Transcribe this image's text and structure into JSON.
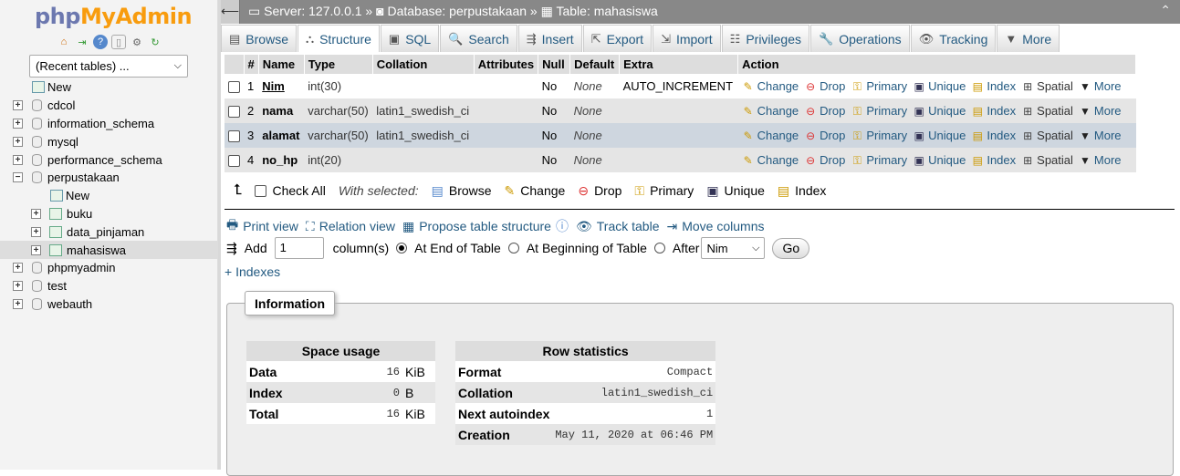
{
  "logo": {
    "part1": "php",
    "part2": "MyAdmin"
  },
  "sidebar": {
    "recent_tables": "(Recent tables) ...",
    "tree": [
      {
        "label": "New",
        "type": "new",
        "level": 0
      },
      {
        "label": "cdcol",
        "type": "db",
        "level": 0
      },
      {
        "label": "information_schema",
        "type": "db",
        "level": 0
      },
      {
        "label": "mysql",
        "type": "db",
        "level": 0
      },
      {
        "label": "performance_schema",
        "type": "db",
        "level": 0
      },
      {
        "label": "perpustakaan",
        "type": "db",
        "level": 0,
        "expanded": true
      },
      {
        "label": "New",
        "type": "new",
        "level": 1
      },
      {
        "label": "buku",
        "type": "table",
        "level": 1
      },
      {
        "label": "data_pinjaman",
        "type": "table",
        "level": 1
      },
      {
        "label": "mahasiswa",
        "type": "table",
        "level": 1,
        "selected": true
      },
      {
        "label": "phpmyadmin",
        "type": "db",
        "level": 0
      },
      {
        "label": "test",
        "type": "db",
        "level": 0
      },
      {
        "label": "webauth",
        "type": "db",
        "level": 0
      }
    ]
  },
  "breadcrumb": {
    "server": "Server: 127.0.0.1",
    "sep": "»",
    "database": "Database: perpustakaan",
    "table": "Table: mahasiswa"
  },
  "tabs": [
    {
      "label": "Browse",
      "icon": "browse-icon",
      "glyph": "▤"
    },
    {
      "label": "Structure",
      "icon": "structure-icon",
      "glyph": "⛬",
      "active": true
    },
    {
      "label": "SQL",
      "icon": "sql-icon",
      "glyph": "▣"
    },
    {
      "label": "Search",
      "icon": "search-icon",
      "glyph": "🔍"
    },
    {
      "label": "Insert",
      "icon": "insert-icon",
      "glyph": "⇶"
    },
    {
      "label": "Export",
      "icon": "export-icon",
      "glyph": "⇱"
    },
    {
      "label": "Import",
      "icon": "import-icon",
      "glyph": "⇲"
    },
    {
      "label": "Privileges",
      "icon": "privileges-icon",
      "glyph": "☷"
    },
    {
      "label": "Operations",
      "icon": "wrench-icon",
      "glyph": "🔧"
    },
    {
      "label": "Tracking",
      "icon": "eye-icon",
      "glyph": "👁"
    },
    {
      "label": "More",
      "icon": "caret-down-icon",
      "glyph": "▼"
    }
  ],
  "structure": {
    "headers": [
      "#",
      "Name",
      "Type",
      "Collation",
      "Attributes",
      "Null",
      "Default",
      "Extra",
      "Action"
    ],
    "rows": [
      {
        "num": "1",
        "name": "Nim",
        "type": "int(30)",
        "collation": "",
        "attributes": "",
        "null": "No",
        "default": "None",
        "extra": "AUTO_INCREMENT"
      },
      {
        "num": "2",
        "name": "nama",
        "type": "varchar(50)",
        "collation": "latin1_swedish_ci",
        "attributes": "",
        "null": "No",
        "default": "None",
        "extra": ""
      },
      {
        "num": "3",
        "name": "alamat",
        "type": "varchar(50)",
        "collation": "latin1_swedish_ci",
        "attributes": "",
        "null": "No",
        "default": "None",
        "extra": ""
      },
      {
        "num": "4",
        "name": "no_hp",
        "type": "int(20)",
        "collation": "",
        "attributes": "",
        "null": "No",
        "default": "None",
        "extra": ""
      }
    ],
    "actions": [
      "Change",
      "Drop",
      "Primary",
      "Unique",
      "Index",
      "Spatial",
      "More"
    ]
  },
  "with_selected": {
    "check_all": "Check All",
    "label": "With selected:",
    "actions": [
      "Browse",
      "Change",
      "Drop",
      "Primary",
      "Unique",
      "Index"
    ]
  },
  "links": [
    "Print view",
    "Relation view",
    "Propose table structure",
    "Track table",
    "Move columns"
  ],
  "add_row": {
    "add": "Add",
    "count": "1",
    "columns": "column(s)",
    "at_end": "At End of Table",
    "at_begin": "At Beginning of Table",
    "after": "After",
    "after_value": "Nim",
    "go": "Go"
  },
  "indexes_link": "+ Indexes",
  "information": {
    "legend": "Information",
    "space_usage": {
      "title": "Space usage",
      "rows": [
        {
          "label": "Data",
          "value": "16",
          "unit": "KiB"
        },
        {
          "label": "Index",
          "value": "0",
          "unit": "B"
        },
        {
          "label": "Total",
          "value": "16",
          "unit": "KiB"
        }
      ]
    },
    "row_statistics": {
      "title": "Row statistics",
      "rows": [
        {
          "label": "Format",
          "value": "Compact"
        },
        {
          "label": "Collation",
          "value": "latin1_swedish_ci"
        },
        {
          "label": "Next autoindex",
          "value": "1"
        },
        {
          "label": "Creation",
          "value": "May 11, 2020 at 06:46 PM"
        }
      ]
    }
  }
}
